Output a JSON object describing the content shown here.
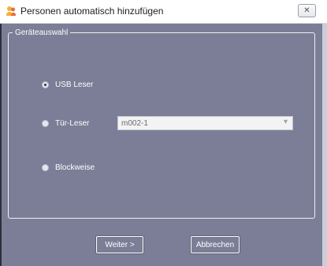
{
  "window": {
    "title": "Personen automatisch hinzufügen",
    "close_glyph": "✕"
  },
  "group": {
    "legend": "Geräteauswahl",
    "options": [
      {
        "label": "USB Leser",
        "checked": true
      },
      {
        "label": "Tür-Leser",
        "checked": false
      },
      {
        "label": "Blockweise",
        "checked": false
      }
    ],
    "device_select": {
      "value": "m002-1",
      "arrow_glyph": "▾"
    }
  },
  "buttons": {
    "next": "Weiter >",
    "cancel": "Abbrechen"
  },
  "icons": {
    "window_icon": "people-add-icon",
    "close": "close-icon"
  },
  "colors": {
    "background": "#7b7e96",
    "titlebar": "#ffffff"
  }
}
